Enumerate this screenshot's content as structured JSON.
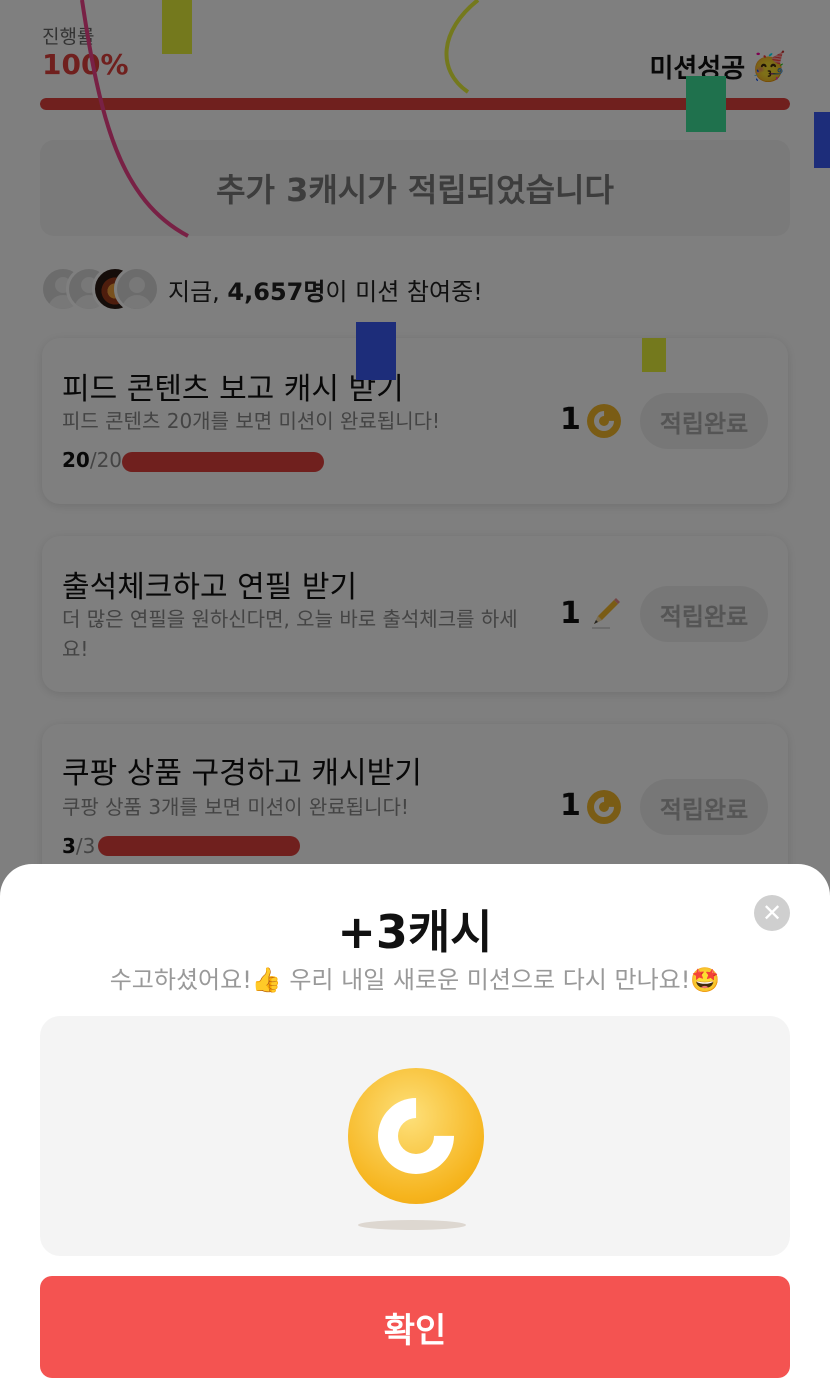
{
  "progress": {
    "label": "진행률",
    "value": "100%",
    "fill_fraction": 1.0,
    "status": "미션성공",
    "status_emoji": "🥳",
    "color": "#e0403d"
  },
  "banner": {
    "text": "추가 3캐시가 적립되었습니다"
  },
  "participants": {
    "prefix": "지금, ",
    "count": "4,657명",
    "suffix": "이 미션 참여중!"
  },
  "missions": [
    {
      "title": "피드 콘텐츠 보고 캐시 받기",
      "description": "피드 콘텐츠 20개를 보면 미션이 완료됩니다!",
      "progress_current": "20",
      "progress_total": "/20",
      "progress_fraction": 1.0,
      "reward": "1",
      "reward_icon": "cash-coin-icon",
      "button": "적립완료"
    },
    {
      "title": "출석체크하고 연필 받기",
      "description": "더 많은 연필을 원하신다면, 오늘 바로 출석체크를 하세요!",
      "reward": "1",
      "reward_icon": "pencil-icon",
      "button": "적립완료"
    },
    {
      "title": "쿠팡 상품 구경하고 캐시받기",
      "description": "쿠팡 상품 3개를 보면 미션이 완료됩니다!",
      "progress_current": "3",
      "progress_total": "/3",
      "progress_fraction": 1.0,
      "reward": "1",
      "reward_icon": "cash-coin-icon",
      "button": "적립완료"
    }
  ],
  "sheet": {
    "title": "+3캐시",
    "subtitle": "수고하셨어요!👍 우리 내일 새로운 미션으로 다시 만나요!🤩",
    "close_icon": "close-icon",
    "confirm": "확인",
    "accent": "#f45351"
  }
}
